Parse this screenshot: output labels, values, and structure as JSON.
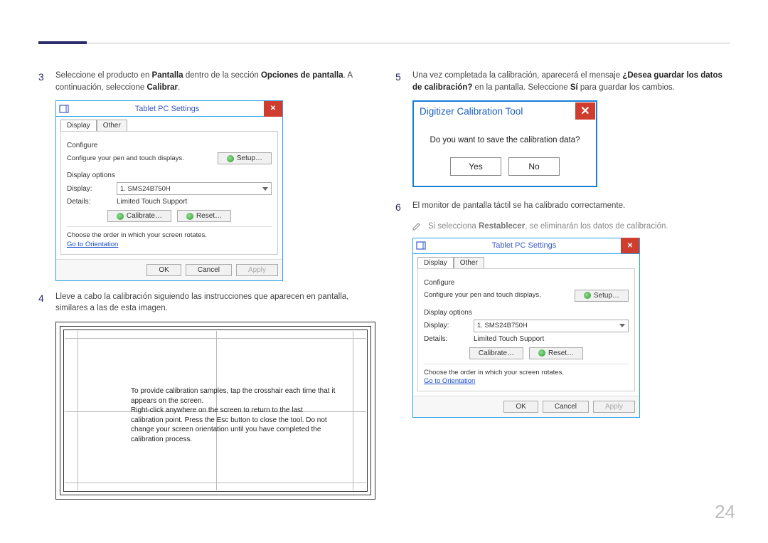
{
  "page_number": "24",
  "steps": {
    "3": {
      "num": "3",
      "pre": "Seleccione el producto en ",
      "b1": "Pantalla",
      "mid": " dentro de la sección ",
      "b2": "Opciones de pantalla",
      "post": ". A continuación, seleccione ",
      "b3": "Calibrar",
      "end": "."
    },
    "4": {
      "num": "4",
      "text": "Lleve a cabo la calibración siguiendo las instrucciones que aparecen en pantalla, similares a las de esta imagen."
    },
    "5": {
      "num": "5",
      "pre": "Una vez completada la calibración, aparecerá el mensaje ",
      "b1": "¿Desea guardar los datos de calibración?",
      "mid": " en la pantalla. Seleccione ",
      "b2": "Sí",
      "post": " para guardar los cambios."
    },
    "6": {
      "num": "6",
      "text": "El monitor de pantalla táctil se ha calibrado correctamente."
    }
  },
  "note": {
    "pre": "Si selecciona ",
    "b": "Restablecer",
    "post": ", se eliminarán los datos de calibración."
  },
  "win": {
    "title": "Tablet PC Settings",
    "tabs": {
      "display": "Display",
      "other": "Other"
    },
    "configure_label": "Configure",
    "configure_desc": "Configure your pen and touch displays.",
    "setup_btn": "Setup…",
    "display_options_label": "Display options",
    "display_label": "Display:",
    "display_value": "1. SMS24B750H",
    "details_label": "Details:",
    "details_value": "Limited Touch Support",
    "calibrate_btn": "Calibrate…",
    "reset_btn": "Reset…",
    "rotate_text": "Choose the order in which your screen rotates.",
    "orientation_link": "Go to Orientation",
    "ok": "OK",
    "cancel": "Cancel",
    "apply": "Apply"
  },
  "calib_msg": {
    "l1": "To provide calibration samples, tap the crosshair each time that it appears on the screen.",
    "l2": "Right-click anywhere on the screen to return to the last calibration point. Press the Esc button to close the tool. Do not change your screen orientation until you have completed the calibration process."
  },
  "dialog": {
    "title": "Digitizer Calibration Tool",
    "body": "Do you want to save the calibration data?",
    "yes": "Yes",
    "no": "No"
  }
}
